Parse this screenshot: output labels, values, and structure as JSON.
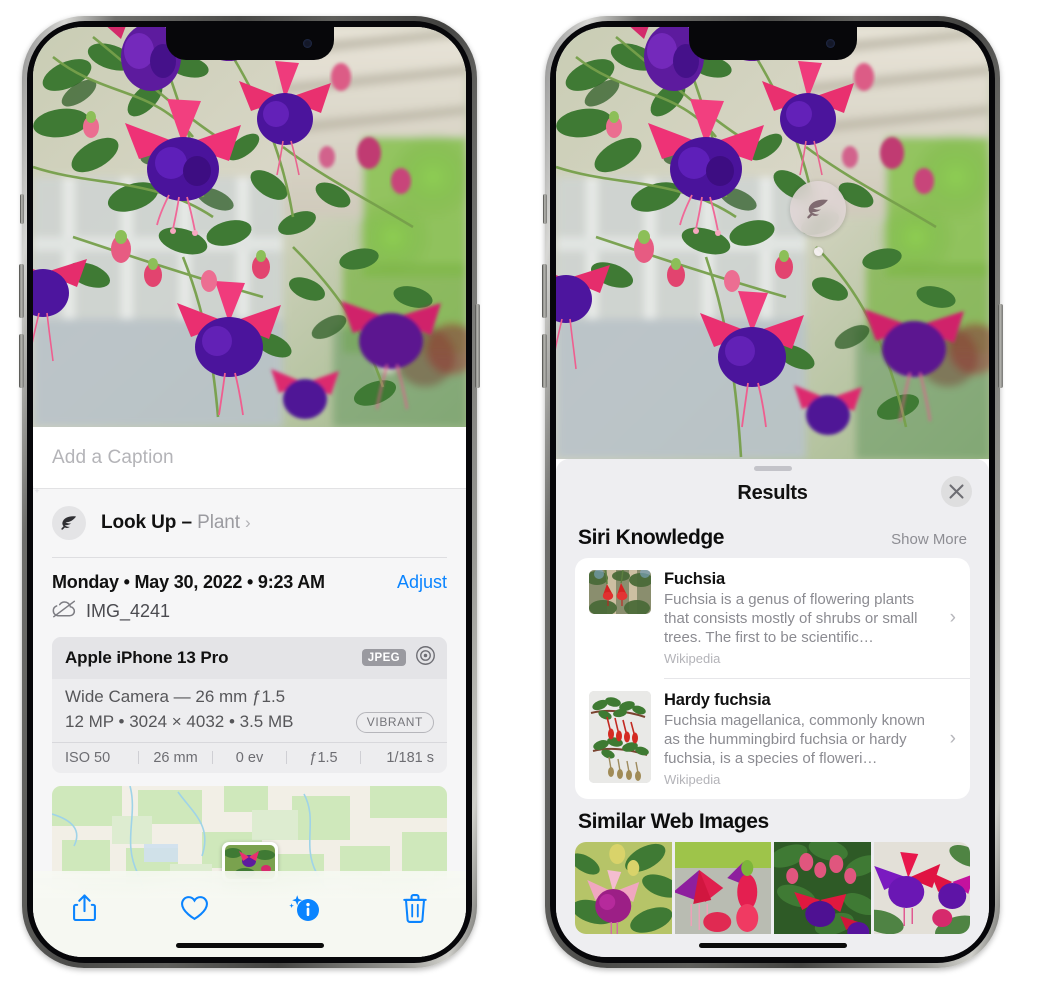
{
  "left_phone": {
    "photo": {
      "alt_name": "fuchsia-flowers-photo"
    },
    "caption": {
      "placeholder": "Add a Caption",
      "value": ""
    },
    "look_up": {
      "icon": "leaf-icon",
      "label": "Look Up",
      "dash": " – ",
      "category": "Plant",
      "chevron": "›"
    },
    "metadata": {
      "datetime": "Monday • May 30, 2022 • 9:23 AM",
      "adjust_label": "Adjust",
      "cloud_icon": "icloud-slash-icon",
      "filename": "IMG_4241"
    },
    "camera_card": {
      "model": "Apple iPhone 13 Pro",
      "format_badge": "JPEG",
      "aperture_icon": "aperture-icon",
      "lens_line": "Wide Camera — 26 mm ƒ1.5",
      "specs_line": "12 MP • 3024 × 4032 • 3.5 MB",
      "style_badge": "VIBRANT",
      "exif": [
        "ISO 50",
        "26 mm",
        "0 ev",
        "ƒ1.5",
        "1/181 s"
      ]
    },
    "toolbar": [
      {
        "name": "share-button",
        "icon": "share-icon"
      },
      {
        "name": "favorite-button",
        "icon": "heart-icon"
      },
      {
        "name": "info-button",
        "icon": "info-sparkle-icon"
      },
      {
        "name": "delete-button",
        "icon": "trash-icon"
      }
    ],
    "accent_color": "#0a84ff"
  },
  "right_phone": {
    "photo": {
      "alt_name": "fuchsia-flowers-photo"
    },
    "visual_look_up_badge": {
      "icon": "leaf-icon"
    },
    "results_sheet": {
      "title": "Results",
      "close_label": "✕",
      "sections": [
        {
          "title": "Siri Knowledge",
          "action": "Show More",
          "items": [
            {
              "title": "Fuchsia",
              "description": "Fuchsia is a genus of flowering plants that consists mostly of shrubs or small trees. The first to be scientific…",
              "source": "Wikipedia",
              "chevron": "›",
              "thumb": "fuchsia-red-blooms-thumb"
            },
            {
              "title": "Hardy fuchsia",
              "description": "Fuchsia magellanica, commonly known as the hummingbird fuchsia or hardy fuchsia, is a species of floweri…",
              "source": "Wikipedia",
              "chevron": "›",
              "thumb": "hardy-fuchsia-branch-thumb"
            }
          ]
        },
        {
          "title": "Similar Web Images",
          "images": [
            "fuchsia-web-image-1",
            "fuchsia-web-image-2",
            "fuchsia-web-image-3",
            "fuchsia-web-image-4"
          ]
        }
      ]
    }
  }
}
